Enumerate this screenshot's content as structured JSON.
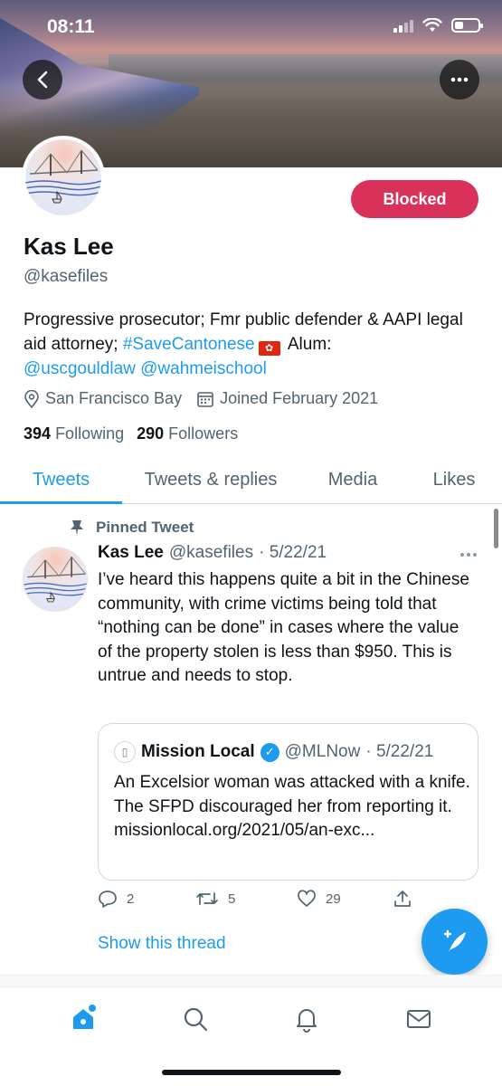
{
  "status_bar": {
    "time": "08:11"
  },
  "profile": {
    "name": "Kas Lee",
    "handle": "@kasefiles",
    "action_button_label": "Blocked",
    "bio_text_1": "Progressive prosecutor; Fmr public defender & AAPI legal aid attorney; ",
    "bio_hashtag": "#SaveCantonese",
    "bio_text_2": " Alum: ",
    "bio_link_1": "@uscgouldlaw",
    "bio_link_2": "@wahmeischool",
    "location": "San Francisco Bay",
    "joined": "Joined February 2021",
    "following_count": "394",
    "following_label": "Following",
    "followers_count": "290",
    "followers_label": "Followers"
  },
  "tabs": [
    {
      "label": "Tweets",
      "active": true
    },
    {
      "label": "Tweets & replies",
      "active": false
    },
    {
      "label": "Media",
      "active": false
    },
    {
      "label": "Likes",
      "active": false
    }
  ],
  "tweet": {
    "pinned_label": "Pinned Tweet",
    "author_name": "Kas Lee",
    "author_handle": "@kasefiles",
    "date": "· 5/22/21",
    "text": "I’ve heard this happens quite a bit in the Chinese community, with crime victims being told that “nothing can be done” in cases where the value of the property stolen is less than $950. This is untrue and needs to stop.",
    "quote": {
      "name": "Mission Local",
      "handle": "@MLNow",
      "date": "· 5/22/21",
      "text": "An Excelsior woman was attacked with a knife. The SFPD discouraged her from reporting it. missionlocal.org/2021/05/an-exc..."
    },
    "reply_count": "2",
    "retweet_count": "5",
    "like_count": "29",
    "show_thread_label": "Show this thread"
  },
  "icons": {
    "back": "chevron-left-icon",
    "more": "more-icon",
    "location": "location-pin-icon",
    "calendar": "calendar-icon",
    "pin": "pin-icon",
    "reply": "reply-icon",
    "retweet": "retweet-icon",
    "like": "heart-icon",
    "share": "share-icon",
    "compose": "compose-icon",
    "home": "home-icon",
    "search": "search-icon",
    "notifications": "bell-icon",
    "messages": "mail-icon"
  },
  "colors": {
    "accent": "#1d9bf0",
    "blocked": "#d9325a",
    "muted": "#536471"
  }
}
